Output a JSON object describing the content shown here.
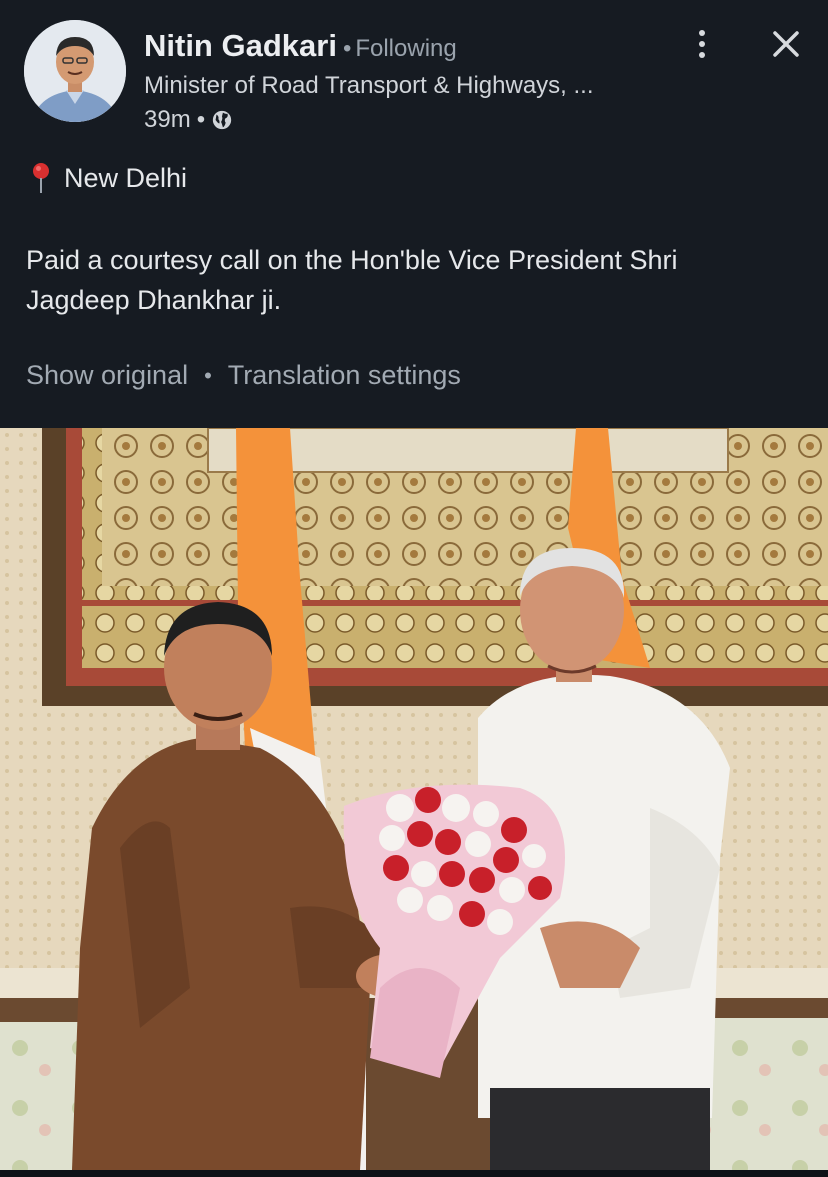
{
  "post": {
    "author": {
      "name": "Nitin Gadkari",
      "separator": "•",
      "follow_status": "Following",
      "title": "Minister of Road Transport & Highways, ...",
      "time": "39m",
      "time_separator": "•",
      "visibility_icon": "globe-icon"
    },
    "location": {
      "icon": "location-pin-icon",
      "name": "New Delhi"
    },
    "text": "Paid a courtesy call on the Hon'ble Vice President Shri Jagdeep Dhankhar ji.",
    "translation": {
      "show_original": "Show original",
      "separator": "•",
      "settings": "Translation settings"
    }
  },
  "toolbar": {
    "more_icon": "more-vertical-icon",
    "close_icon": "close-icon"
  },
  "colors": {
    "background": "#161b22",
    "text_primary": "#e6e8eb",
    "text_secondary": "#9aa3ad",
    "pin_red": "#d93030"
  }
}
